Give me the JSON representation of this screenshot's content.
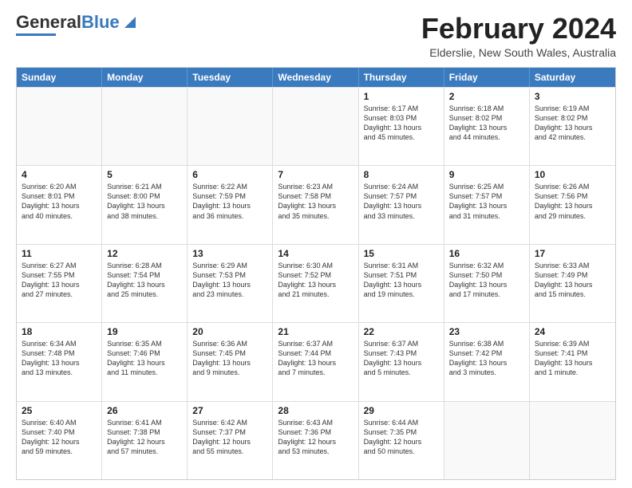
{
  "header": {
    "logo_general": "General",
    "logo_blue": "Blue",
    "month_title": "February 2024",
    "location": "Elderslie, New South Wales, Australia"
  },
  "weekdays": [
    "Sunday",
    "Monday",
    "Tuesday",
    "Wednesday",
    "Thursday",
    "Friday",
    "Saturday"
  ],
  "rows": [
    [
      {
        "day": "",
        "text": ""
      },
      {
        "day": "",
        "text": ""
      },
      {
        "day": "",
        "text": ""
      },
      {
        "day": "",
        "text": ""
      },
      {
        "day": "1",
        "text": "Sunrise: 6:17 AM\nSunset: 8:03 PM\nDaylight: 13 hours\nand 45 minutes."
      },
      {
        "day": "2",
        "text": "Sunrise: 6:18 AM\nSunset: 8:02 PM\nDaylight: 13 hours\nand 44 minutes."
      },
      {
        "day": "3",
        "text": "Sunrise: 6:19 AM\nSunset: 8:02 PM\nDaylight: 13 hours\nand 42 minutes."
      }
    ],
    [
      {
        "day": "4",
        "text": "Sunrise: 6:20 AM\nSunset: 8:01 PM\nDaylight: 13 hours\nand 40 minutes."
      },
      {
        "day": "5",
        "text": "Sunrise: 6:21 AM\nSunset: 8:00 PM\nDaylight: 13 hours\nand 38 minutes."
      },
      {
        "day": "6",
        "text": "Sunrise: 6:22 AM\nSunset: 7:59 PM\nDaylight: 13 hours\nand 36 minutes."
      },
      {
        "day": "7",
        "text": "Sunrise: 6:23 AM\nSunset: 7:58 PM\nDaylight: 13 hours\nand 35 minutes."
      },
      {
        "day": "8",
        "text": "Sunrise: 6:24 AM\nSunset: 7:57 PM\nDaylight: 13 hours\nand 33 minutes."
      },
      {
        "day": "9",
        "text": "Sunrise: 6:25 AM\nSunset: 7:57 PM\nDaylight: 13 hours\nand 31 minutes."
      },
      {
        "day": "10",
        "text": "Sunrise: 6:26 AM\nSunset: 7:56 PM\nDaylight: 13 hours\nand 29 minutes."
      }
    ],
    [
      {
        "day": "11",
        "text": "Sunrise: 6:27 AM\nSunset: 7:55 PM\nDaylight: 13 hours\nand 27 minutes."
      },
      {
        "day": "12",
        "text": "Sunrise: 6:28 AM\nSunset: 7:54 PM\nDaylight: 13 hours\nand 25 minutes."
      },
      {
        "day": "13",
        "text": "Sunrise: 6:29 AM\nSunset: 7:53 PM\nDaylight: 13 hours\nand 23 minutes."
      },
      {
        "day": "14",
        "text": "Sunrise: 6:30 AM\nSunset: 7:52 PM\nDaylight: 13 hours\nand 21 minutes."
      },
      {
        "day": "15",
        "text": "Sunrise: 6:31 AM\nSunset: 7:51 PM\nDaylight: 13 hours\nand 19 minutes."
      },
      {
        "day": "16",
        "text": "Sunrise: 6:32 AM\nSunset: 7:50 PM\nDaylight: 13 hours\nand 17 minutes."
      },
      {
        "day": "17",
        "text": "Sunrise: 6:33 AM\nSunset: 7:49 PM\nDaylight: 13 hours\nand 15 minutes."
      }
    ],
    [
      {
        "day": "18",
        "text": "Sunrise: 6:34 AM\nSunset: 7:48 PM\nDaylight: 13 hours\nand 13 minutes."
      },
      {
        "day": "19",
        "text": "Sunrise: 6:35 AM\nSunset: 7:46 PM\nDaylight: 13 hours\nand 11 minutes."
      },
      {
        "day": "20",
        "text": "Sunrise: 6:36 AM\nSunset: 7:45 PM\nDaylight: 13 hours\nand 9 minutes."
      },
      {
        "day": "21",
        "text": "Sunrise: 6:37 AM\nSunset: 7:44 PM\nDaylight: 13 hours\nand 7 minutes."
      },
      {
        "day": "22",
        "text": "Sunrise: 6:37 AM\nSunset: 7:43 PM\nDaylight: 13 hours\nand 5 minutes."
      },
      {
        "day": "23",
        "text": "Sunrise: 6:38 AM\nSunset: 7:42 PM\nDaylight: 13 hours\nand 3 minutes."
      },
      {
        "day": "24",
        "text": "Sunrise: 6:39 AM\nSunset: 7:41 PM\nDaylight: 13 hours\nand 1 minute."
      }
    ],
    [
      {
        "day": "25",
        "text": "Sunrise: 6:40 AM\nSunset: 7:40 PM\nDaylight: 12 hours\nand 59 minutes."
      },
      {
        "day": "26",
        "text": "Sunrise: 6:41 AM\nSunset: 7:38 PM\nDaylight: 12 hours\nand 57 minutes."
      },
      {
        "day": "27",
        "text": "Sunrise: 6:42 AM\nSunset: 7:37 PM\nDaylight: 12 hours\nand 55 minutes."
      },
      {
        "day": "28",
        "text": "Sunrise: 6:43 AM\nSunset: 7:36 PM\nDaylight: 12 hours\nand 53 minutes."
      },
      {
        "day": "29",
        "text": "Sunrise: 6:44 AM\nSunset: 7:35 PM\nDaylight: 12 hours\nand 50 minutes."
      },
      {
        "day": "",
        "text": ""
      },
      {
        "day": "",
        "text": ""
      }
    ]
  ]
}
